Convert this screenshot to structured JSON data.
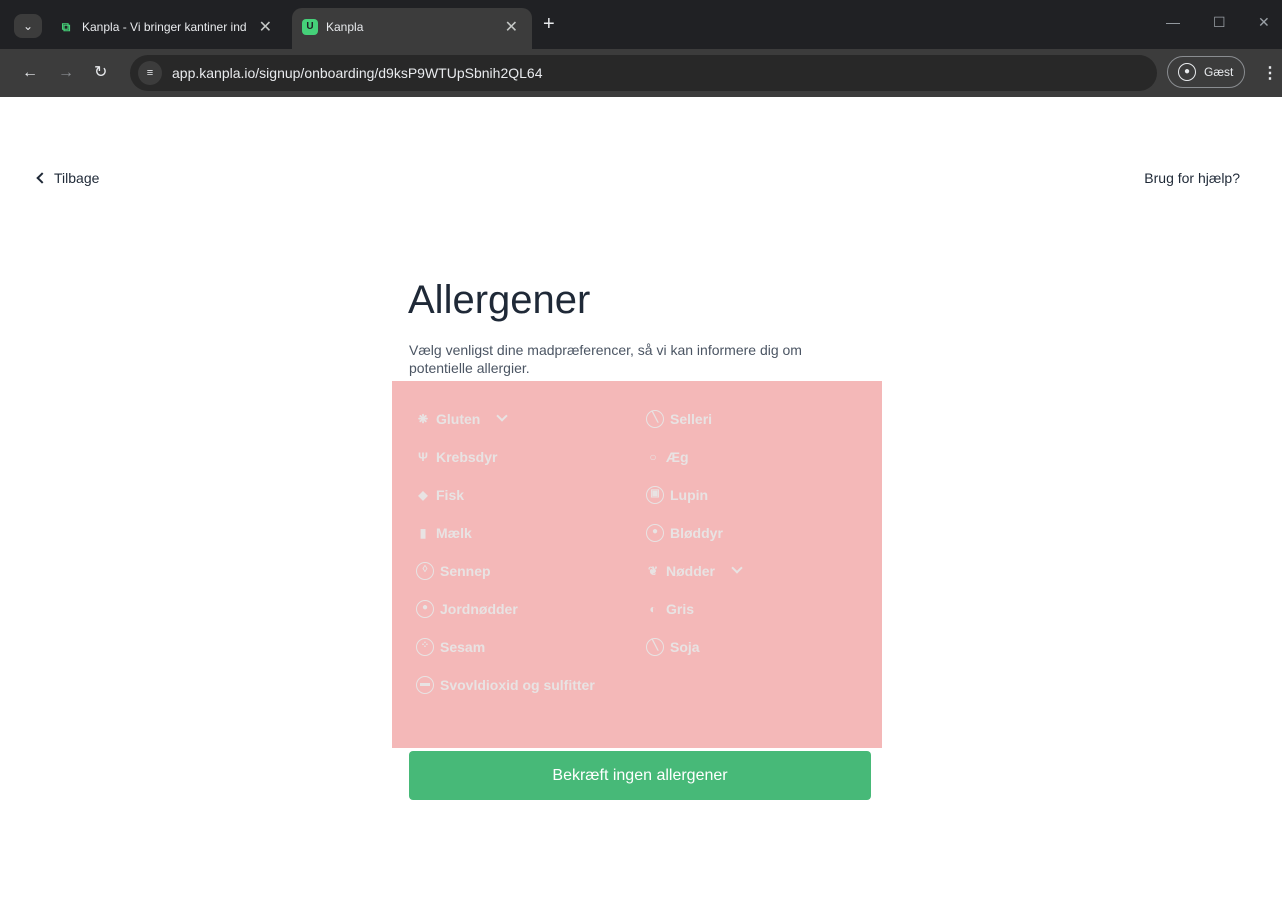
{
  "browser": {
    "tabs": [
      {
        "title": "Kanpla - Vi bringer kantiner ind",
        "active": false
      },
      {
        "title": "Kanpla",
        "active": true
      }
    ],
    "url": "app.kanpla.io/signup/onboarding/d9ksP9WTUpSbnih2QL64",
    "profile_label": "Gæst"
  },
  "page": {
    "back_label": "Tilbage",
    "help_label": "Brug for hjælp?",
    "title": "Allergener",
    "subtitle": "Vælg venligst dine madpræferencer, så vi kan informere dig om potentielle allergier.",
    "allergens_left": [
      {
        "label": "Gluten",
        "icon": "wheat-icon",
        "dropdown": true
      },
      {
        "label": "Krebsdyr",
        "icon": "lobster-icon",
        "dropdown": false
      },
      {
        "label": "Fisk",
        "icon": "fish-icon",
        "dropdown": false
      },
      {
        "label": "Mælk",
        "icon": "milk-icon",
        "dropdown": false
      },
      {
        "label": "Sennep",
        "icon": "mustard-icon",
        "dropdown": false
      },
      {
        "label": "Jordnødder",
        "icon": "peanut-icon",
        "dropdown": false
      },
      {
        "label": "Sesam",
        "icon": "sesame-icon",
        "dropdown": false
      },
      {
        "label": "Svovldioxid og sulfitter",
        "icon": "sulfite-icon",
        "dropdown": false
      }
    ],
    "allergens_right": [
      {
        "label": "Selleri",
        "icon": "celery-icon",
        "dropdown": false
      },
      {
        "label": "Æg",
        "icon": "egg-icon",
        "dropdown": false
      },
      {
        "label": "Lupin",
        "icon": "lupin-icon",
        "dropdown": false
      },
      {
        "label": "Bløddyr",
        "icon": "mollusc-icon",
        "dropdown": false
      },
      {
        "label": "Nødder",
        "icon": "nuts-icon",
        "dropdown": true
      },
      {
        "label": "Gris",
        "icon": "pig-icon",
        "dropdown": false
      },
      {
        "label": "Soja",
        "icon": "soy-icon",
        "dropdown": false
      }
    ],
    "confirm_label": "Bekræft ingen allergener"
  },
  "colors": {
    "accent": "#47b978",
    "panel_overlay": "#f4b8b8",
    "text": "#1f2937"
  }
}
